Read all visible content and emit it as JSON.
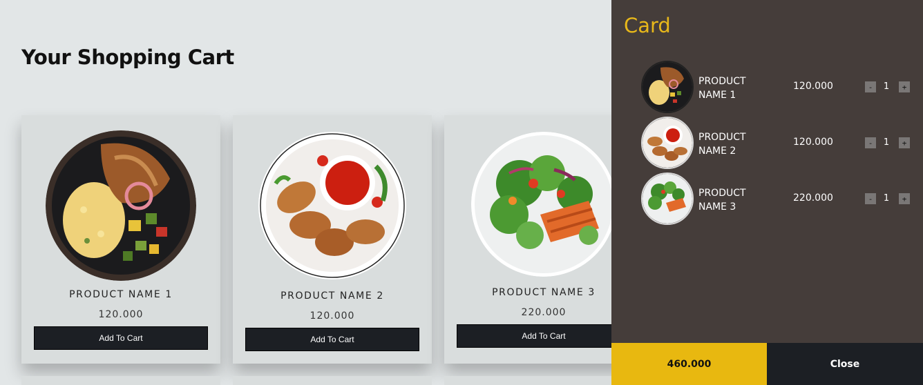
{
  "page": {
    "title": "Your Shopping Cart"
  },
  "products": [
    {
      "name": "PRODUCT NAME 1",
      "price": "120.000",
      "button": "Add To Cart",
      "image": "food-plate-pulled-pork-icon"
    },
    {
      "name": "PRODUCT NAME 2",
      "price": "120.000",
      "button": "Add To Cart",
      "image": "food-plate-chicken-wings-icon"
    },
    {
      "name": "PRODUCT NAME 3",
      "price": "220.000",
      "button": "Add To Cart",
      "image": "food-plate-salmon-salad-icon"
    }
  ],
  "cart": {
    "title": "Card",
    "items": [
      {
        "name": "PRODUCT NAME 1",
        "price": "120.000",
        "qty": "1",
        "minus": "-",
        "plus": "+"
      },
      {
        "name": "PRODUCT NAME 2",
        "price": "120.000",
        "qty": "1",
        "minus": "-",
        "plus": "+"
      },
      {
        "name": "PRODUCT NAME 3",
        "price": "220.000",
        "qty": "1",
        "minus": "-",
        "plus": "+"
      }
    ],
    "total": "460.000",
    "close_label": "Close"
  },
  "colors": {
    "accent": "#e8b810",
    "panel": "#453d3a",
    "button": "#1c1f24",
    "background": "#e2e6e7"
  }
}
